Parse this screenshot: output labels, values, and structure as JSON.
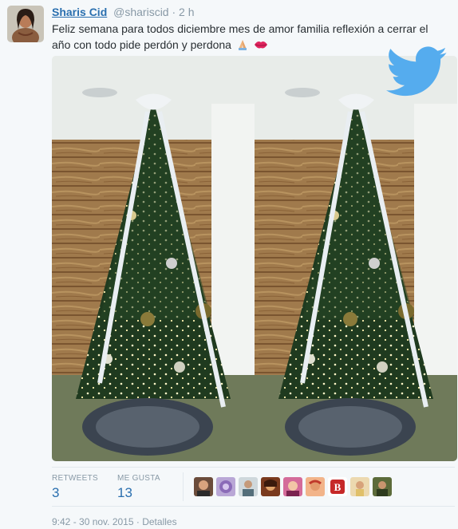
{
  "tweet": {
    "name": "Sharis Cid",
    "handle": "@shariscid",
    "separator": "·",
    "time": "2 h",
    "text": "Feliz semana para todos diciembre mes de amor familia reflexión a cerrar el año con todo pide perdón y perdona",
    "emojis": [
      "folded-hands-icon",
      "kiss-lips-icon"
    ]
  },
  "stats": {
    "retweets_label": "RETWEETS",
    "retweets_value": "3",
    "likes_label": "ME GUSTA",
    "likes_value": "13"
  },
  "likers": [
    {
      "icon": "avatar-1"
    },
    {
      "icon": "avatar-2"
    },
    {
      "icon": "avatar-3"
    },
    {
      "icon": "avatar-4"
    },
    {
      "icon": "avatar-5"
    },
    {
      "icon": "avatar-6"
    },
    {
      "icon": "avatar-red-b-logo"
    },
    {
      "icon": "avatar-8"
    },
    {
      "icon": "avatar-9"
    }
  ],
  "footer": {
    "timestamp": "9:42 - 30 nov. 2015",
    "separator": "·",
    "details": "Detalles"
  },
  "colors": {
    "link": "#2a6faf",
    "muted": "#8899a6",
    "text": "#292f33",
    "twitter_blue": "#55acee"
  }
}
